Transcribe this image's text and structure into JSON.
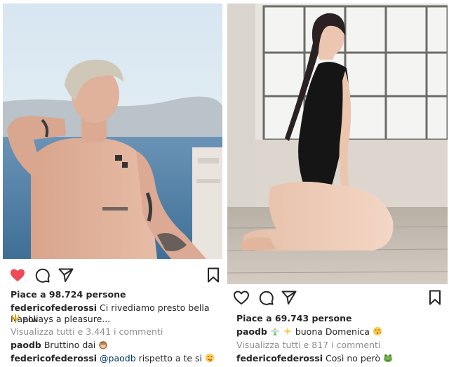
{
  "posts": [
    {
      "liked": true,
      "likes_text": "Piace a 98.724 persone",
      "caption": {
        "username": "federicofederossi",
        "text_line1": "Ci rivediamo presto bella Napoli",
        "text_line2": "always a pleasure..."
      },
      "view_comments": "Visualizza tutti e 3.441 i commenti",
      "comments": [
        {
          "username": "paodb",
          "text": "Bruttino dai",
          "emoji": "see-no-evil-monkey"
        },
        {
          "username": "federicofederossi",
          "mention": "@paodb",
          "text": "rispetto a te si",
          "emoji": "tongue-wink-face"
        }
      ]
    },
    {
      "liked": false,
      "likes_text": "Piace a 69.743 persone",
      "caption": {
        "username": "paodb",
        "text": "buona Domenica",
        "emoji_before": [
          "fairy",
          "sparkles"
        ],
        "emoji_after": "kiss-face"
      },
      "view_comments": "Visualizza tutti e 817 i commenti",
      "comments": [
        {
          "username": "federicofederossi",
          "text": "Così no però",
          "emoji": "frog-face"
        }
      ]
    }
  ],
  "icons": {
    "like": "heart-icon",
    "comment": "comment-bubble-icon",
    "share": "paper-plane-icon",
    "save": "bookmark-icon",
    "caption_emoji_left": "trident-emoji"
  },
  "colors": {
    "liked_heart": "#ed4956",
    "username": "#262626",
    "muted": "#8e8e8e",
    "mention": "#003569"
  }
}
